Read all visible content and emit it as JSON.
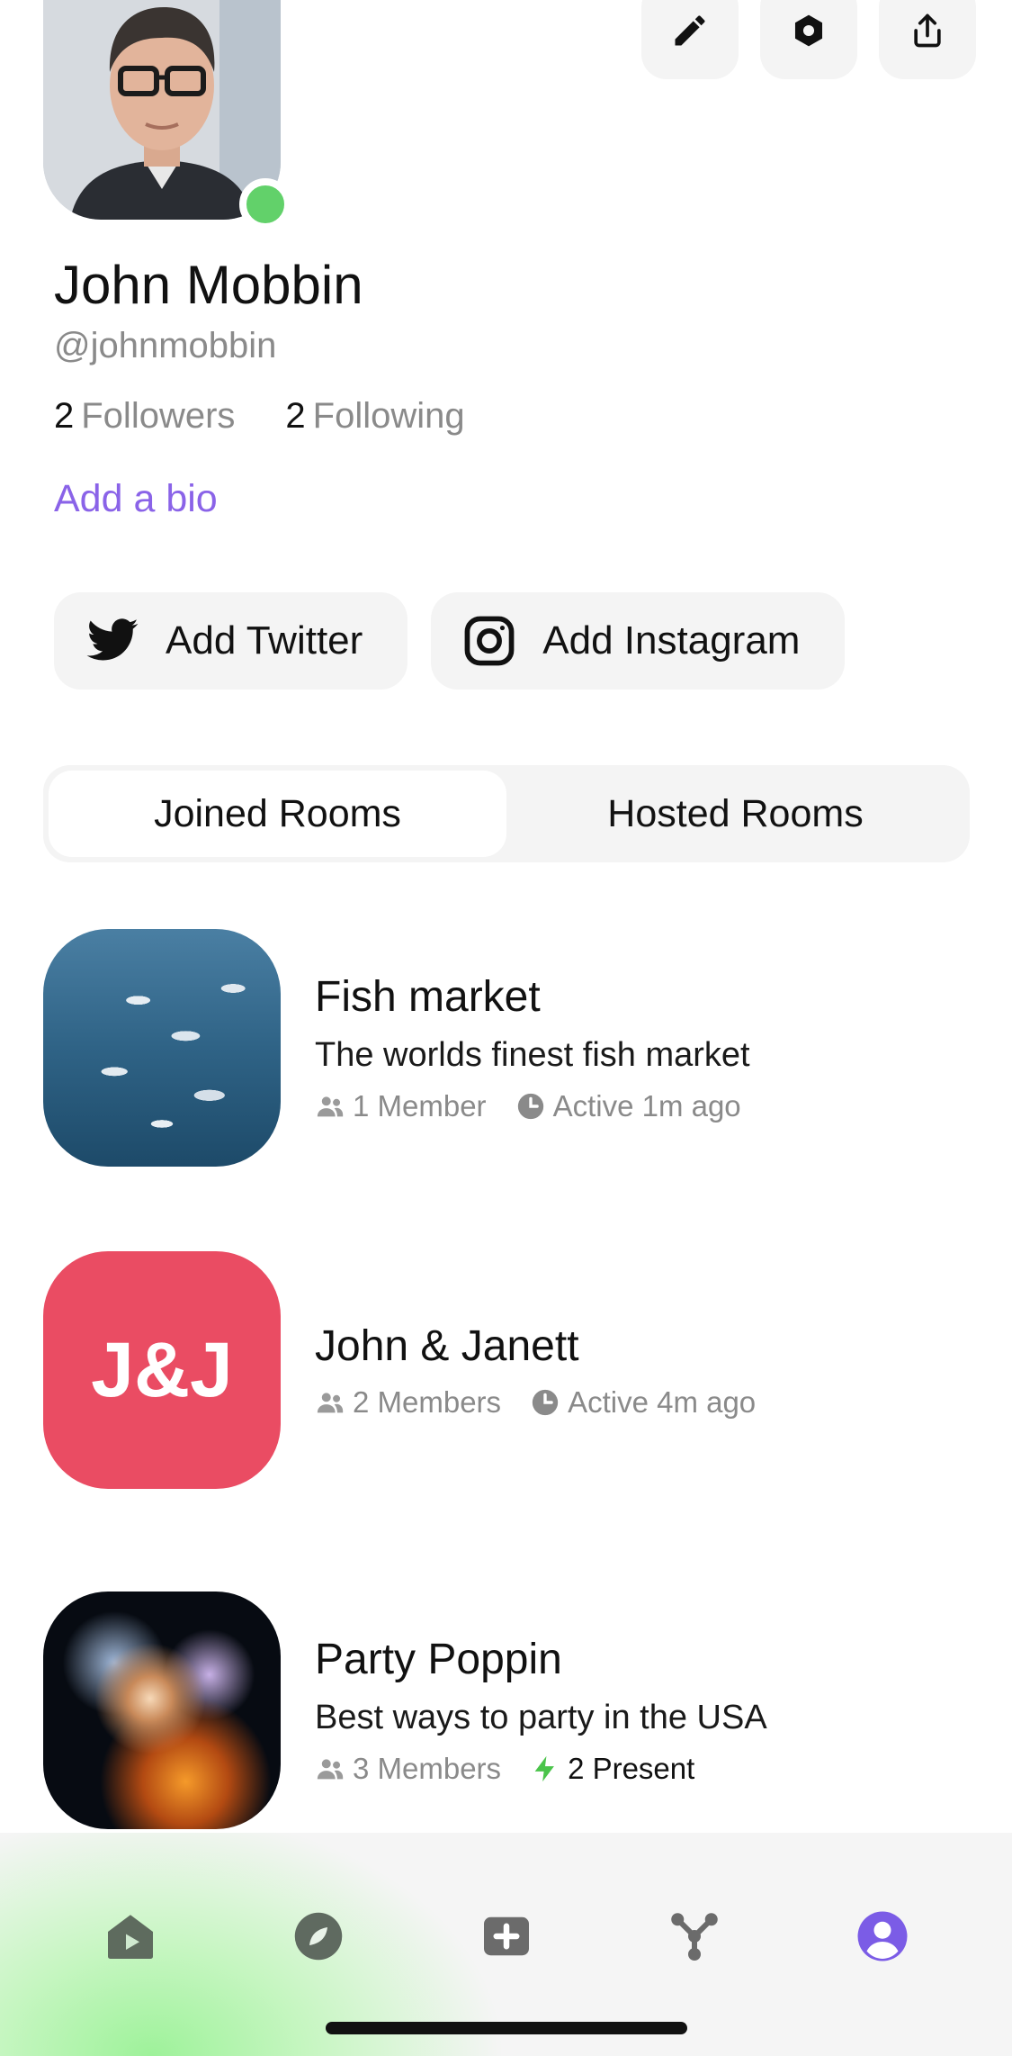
{
  "profile": {
    "name": "John Mobbin",
    "handle": "@johnmobbin",
    "followers_count": "2",
    "followers_label": "Followers",
    "following_count": "2",
    "following_label": "Following",
    "add_bio": "Add a bio",
    "online": true
  },
  "header_actions": [
    "pencil-icon",
    "settings-icon",
    "share-icon"
  ],
  "social": {
    "twitter_label": "Add Twitter",
    "instagram_label": "Add Instagram"
  },
  "tabs": [
    {
      "label": "Joined Rooms",
      "active": true
    },
    {
      "label": "Hosted Rooms",
      "active": false
    }
  ],
  "rooms": [
    {
      "title": "Fish market",
      "description": "The worlds finest fish market",
      "members": "1 Member",
      "status": "Active 1m ago"
    },
    {
      "title": "John & Janett",
      "thumb_text": "J&J",
      "members": "2 Members",
      "status": "Active 4m ago"
    },
    {
      "title": "Party Poppin",
      "description": "Best ways to party in the USA",
      "members": "3 Members",
      "present": "2 Present"
    }
  ],
  "bottom_nav": [
    "home-icon",
    "explore-icon",
    "create-icon",
    "connections-icon",
    "profile-icon"
  ],
  "colors": {
    "accent": "#8a63e8",
    "online": "#62d16a",
    "jj_thumb": "#ea4c63",
    "nav_active": "#7b5ce6",
    "nav_inactive": "#6b6b6b",
    "present_bolt": "#4bc44b"
  }
}
